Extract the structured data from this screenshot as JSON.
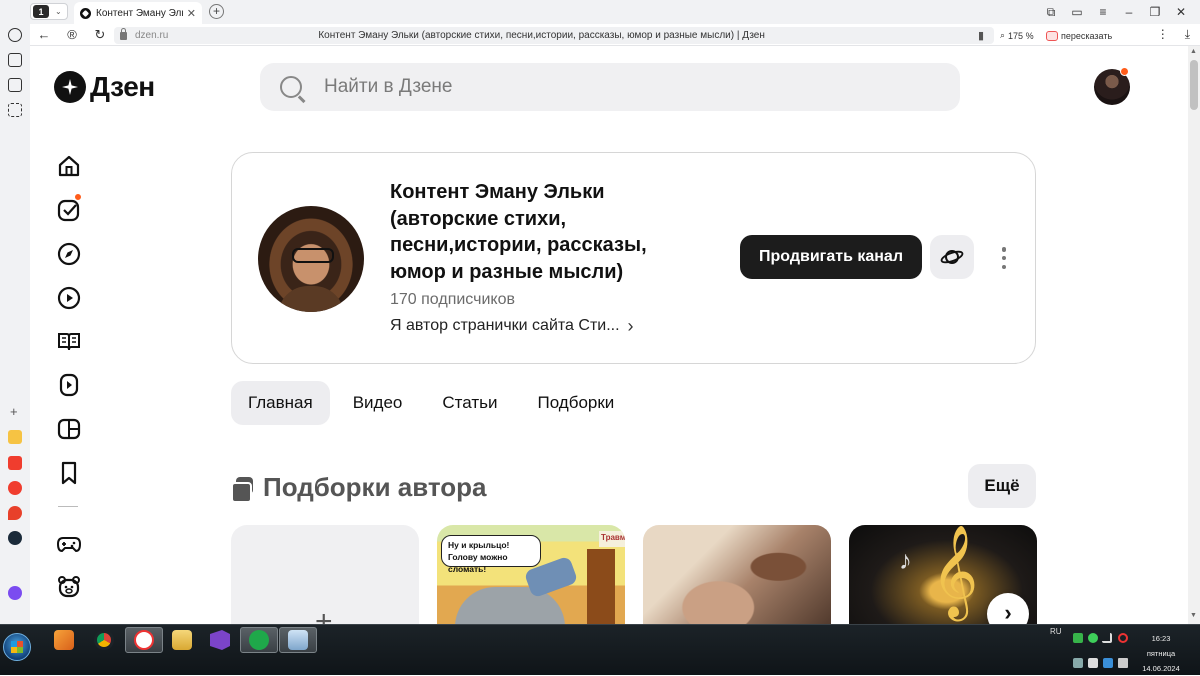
{
  "browser": {
    "tab_count": "1",
    "tab_title": "Контент Эману Эльки",
    "tab_close": "✕",
    "new_tab": "+",
    "url_domain": "dzen.ru",
    "page_title": "Контент Эману Эльки (авторские стихи, песни,истории, рассказы, юмор и разные мысли) | Дзен",
    "zoom": "175 %",
    "retell": "пересказать"
  },
  "header": {
    "logo_text": "Дзен",
    "search_placeholder": "Найти в Дзене"
  },
  "channel": {
    "title": "Контент Эману Эльки (авторские стихи, песни,истории, рассказы, юмор и разные мысли)",
    "subscribers": "170 подписчиков",
    "description": "Я автор странички сайта Сти...",
    "promote_label": "Продвигать канал"
  },
  "tabs": [
    {
      "label": "Главная",
      "active": true
    },
    {
      "label": "Видео",
      "active": false
    },
    {
      "label": "Статьи",
      "active": false
    },
    {
      "label": "Подборки",
      "active": false
    }
  ],
  "collections": {
    "title": "Подборки автора",
    "more_label": "Ещё",
    "add_label": "+",
    "cards": [
      {
        "kind": "comic",
        "bubble": "Ну и крыльцо! Голову можно сломать!",
        "sign": "Травм"
      },
      {
        "kind": "photo-couple"
      },
      {
        "kind": "photo-music"
      }
    ]
  },
  "left_nav": [
    "home-icon",
    "tasks-icon",
    "compass-icon",
    "video-icon",
    "book-icon",
    "shorts-icon",
    "frame-icon",
    "bookmark-icon",
    "gamepad-icon",
    "bear-icon"
  ],
  "taskbar": {
    "lang": "RU",
    "time": "16:23",
    "day": "пятница",
    "date": "14.06.2024"
  },
  "colors": {
    "accent_dot": "#ff5c1a",
    "primary_button": "#1c1c1c",
    "chip_bg": "#ededf0"
  }
}
